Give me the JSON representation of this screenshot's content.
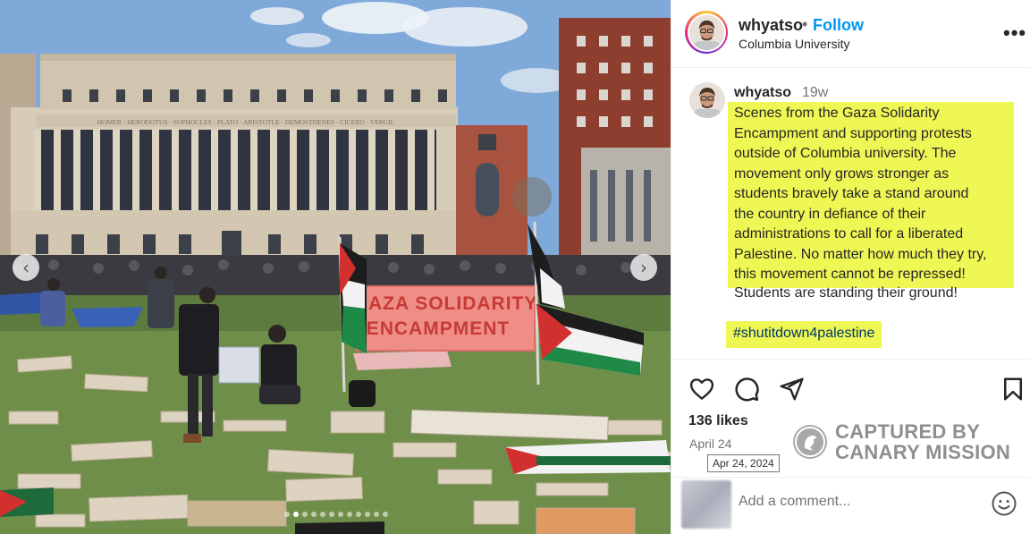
{
  "header": {
    "username": "whyatso",
    "separator": "•",
    "follow_label": "Follow",
    "location": "Columbia University",
    "more_label": "•••"
  },
  "post": {
    "username": "whyatso",
    "time_ago": "19w",
    "caption_highlighted": [
      "Scenes from the Gaza Solidarity",
      "Encampment and supporting protests",
      "outside of Columbia university. The",
      "movement only grows stronger as",
      "students bravely take a stand around",
      "the country in defiance of their",
      "administrations to call for a liberated",
      "Palestine. No matter how much they try,",
      "this movement cannot be repressed!"
    ],
    "caption_tail": "Students are standing their ground!",
    "hashtag": "#shutitdown4palestine"
  },
  "engagement": {
    "likes": "136 likes",
    "date": "April 24",
    "date_tooltip": "Apr 24, 2024"
  },
  "watermark": {
    "line1": "CAPTURED BY",
    "line2": "CANARY MISSION"
  },
  "comment": {
    "placeholder": "Add a comment..."
  },
  "photo": {
    "banner_line1": "GAZA SOLIDARITY",
    "banner_line2": "ENCAMPMENT",
    "frieze": "HOMER · HERODOTUS · SOPHOCLES · PLATO · ARISTOTLE · DEMOSTHENES · CICERO · VERGIL",
    "carousel_total": 12,
    "carousel_active": 1,
    "icons": [
      "chevron-left-icon",
      "chevron-right-icon"
    ]
  },
  "colors": {
    "accent": "#0095f6",
    "highlight": "#eef754",
    "hashtag": "#00376b",
    "muted": "#737373"
  }
}
